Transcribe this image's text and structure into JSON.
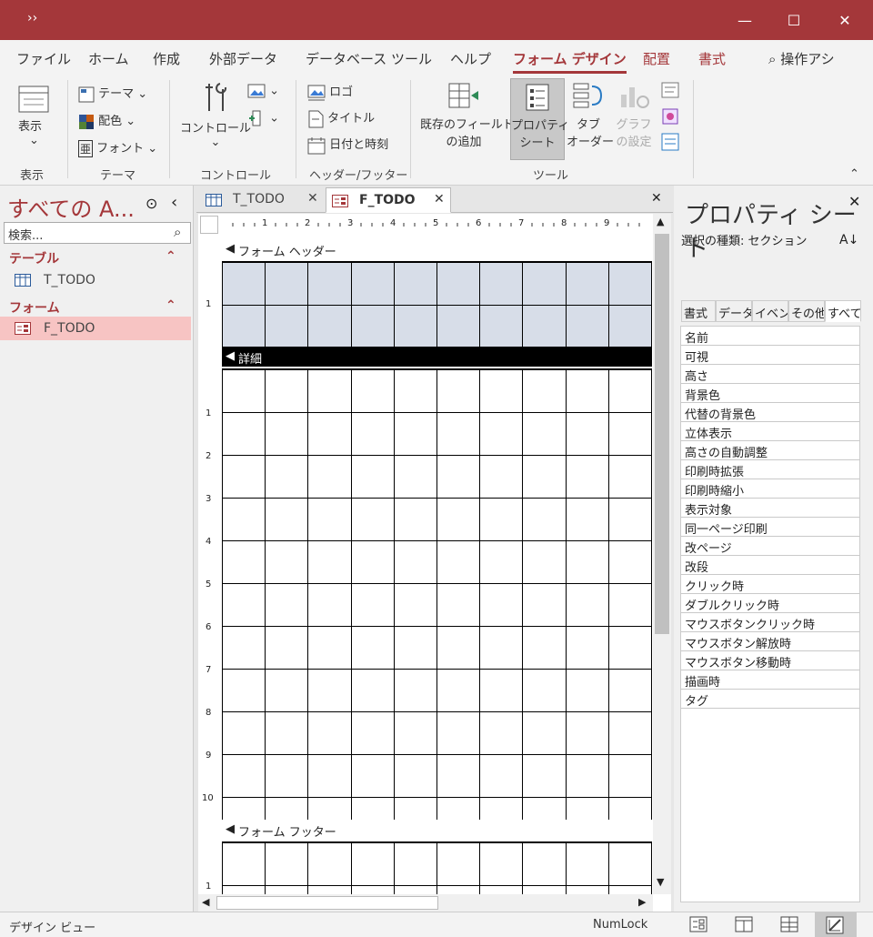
{
  "titlebar": {
    "quick_access": "››",
    "min": "—",
    "max": "☐",
    "close": "✕"
  },
  "ribbon_tabs": [
    {
      "label": "ファイル"
    },
    {
      "label": "ホーム"
    },
    {
      "label": "作成"
    },
    {
      "label": "外部データ"
    },
    {
      "label": "データベース ツール"
    },
    {
      "label": "ヘルプ"
    },
    {
      "label": "フォーム デザイン"
    },
    {
      "label": "配置"
    },
    {
      "label": "書式"
    }
  ],
  "tell_me": "操作アシ",
  "ribbon": {
    "view": {
      "label": "表示",
      "group": "表示"
    },
    "themes": {
      "theme": "テーマ",
      "colors": "配色",
      "fonts": "フォント",
      "group": "テーマ"
    },
    "controls": {
      "controls": "コントロール",
      "group": "コントロール"
    },
    "header_footer": {
      "logo": "ロゴ",
      "title": "タイトル",
      "datetime": "日付と時刻",
      "group": "ヘッダー/フッター"
    },
    "tools": {
      "add_fields_1": "既存のフィールド",
      "add_fields_2": "の追加",
      "property_1": "プロパティ",
      "property_2": "シート",
      "tab_1": "タブ",
      "tab_2": "オーダー",
      "chart_1": "グラフ",
      "chart_2": "の設定",
      "group": "ツール"
    }
  },
  "nav": {
    "title": "すべての A...",
    "search_placeholder": "検索...",
    "tables_header": "テーブル",
    "table_item": "T_TODO",
    "forms_header": "フォーム",
    "form_item": "F_TODO"
  },
  "doc_tabs": [
    {
      "label": "T_TODO"
    },
    {
      "label": "F_TODO"
    }
  ],
  "design": {
    "header_label": "フォーム ヘッダー",
    "detail_label": "詳細",
    "footer_label": "フォーム フッター",
    "ruler_h": [
      "1",
      "2",
      "3",
      "4",
      "5",
      "6",
      "7",
      "8",
      "9"
    ],
    "ruler_v": [
      "1",
      "2",
      "3",
      "4",
      "5",
      "6",
      "7",
      "8",
      "9",
      "10"
    ]
  },
  "props": {
    "title": "プロパティ シート",
    "selection_type": "選択の種類:  セクション",
    "tabs": [
      "書式",
      "データ",
      "イベント",
      "その他",
      "すべて"
    ],
    "rows": [
      "名前",
      "可視",
      "高さ",
      "背景色",
      "代替の背景色",
      "立体表示",
      "高さの自動調整",
      "印刷時拡張",
      "印刷時縮小",
      "表示対象",
      "同一ページ印刷",
      "改ページ",
      "改段",
      "クリック時",
      "ダブルクリック時",
      "マウスボタンクリック時",
      "マウスボタン解放時",
      "マウスボタン移動時",
      "描画時",
      "タグ"
    ]
  },
  "status": {
    "left": "デザイン ビュー",
    "numlock": "NumLock"
  },
  "colors": {
    "accent": "#a4373a",
    "header_grid": "#d7dde8",
    "selected_nav": "#f7c4c3"
  }
}
